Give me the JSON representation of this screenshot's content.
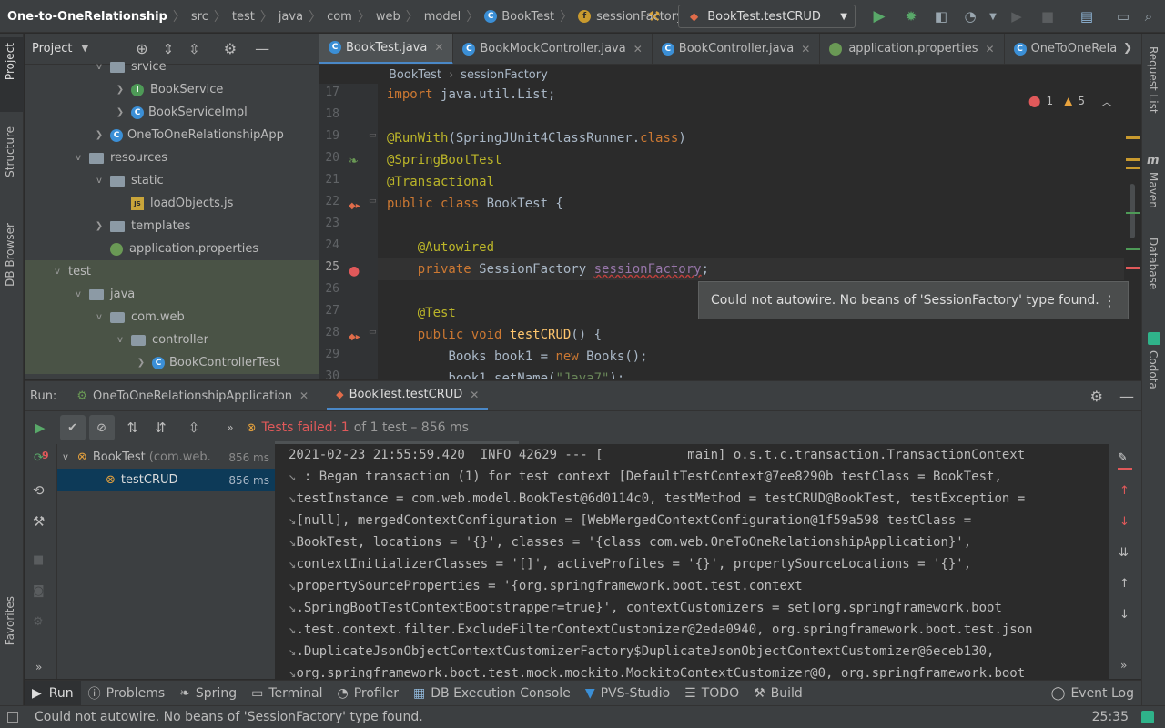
{
  "nav": {
    "breadcrumbs": [
      "One-to-OneRelationship",
      "src",
      "test",
      "java",
      "com",
      "web",
      "model",
      "BookTest",
      "sessionFactory"
    ],
    "run_config": "BookTest.testCRUD"
  },
  "left_strip": {
    "project": "Project",
    "structure": "Structure",
    "db_browser": "DB Browser",
    "favorites": "Favorites"
  },
  "right_strip": {
    "request_list": "Request List",
    "maven": "Maven",
    "database": "Database",
    "codota": "Codota"
  },
  "project_panel": {
    "title": "Project",
    "tree": [
      {
        "label": "srvice",
        "indent": 2,
        "icon": "folder-icon",
        "twisty": "v"
      },
      {
        "label": "BookService",
        "indent": 3,
        "icon": "interface-icon",
        "twisty": ">"
      },
      {
        "label": "BookServiceImpl",
        "indent": 3,
        "icon": "class-icon",
        "twisty": ">"
      },
      {
        "label": "OneToOneRelationshipApp",
        "indent": 2,
        "icon": "class-icon",
        "twisty": ">"
      },
      {
        "label": "resources",
        "indent": 1,
        "icon": "folder-icon",
        "twisty": "v"
      },
      {
        "label": "static",
        "indent": 2,
        "icon": "folder-icon",
        "twisty": "v"
      },
      {
        "label": "loadObjects.js",
        "indent": 3,
        "icon": "js-file-icon",
        "twisty": ""
      },
      {
        "label": "templates",
        "indent": 2,
        "icon": "folder-icon",
        "twisty": ">"
      },
      {
        "label": "application.properties",
        "indent": 2,
        "icon": "properties-file-icon",
        "twisty": ""
      },
      {
        "label": "test",
        "indent": 0,
        "icon": "",
        "twisty": "v",
        "green": true
      },
      {
        "label": "java",
        "indent": 1,
        "icon": "folder-icon",
        "twisty": "v",
        "green": true
      },
      {
        "label": "com.web",
        "indent": 2,
        "icon": "package-icon",
        "twisty": "v",
        "green": true
      },
      {
        "label": "controller",
        "indent": 3,
        "icon": "package-icon",
        "twisty": "v",
        "green": true
      },
      {
        "label": "BookControllerTest",
        "indent": 4,
        "icon": "class-icon",
        "twisty": ">",
        "green": true
      }
    ]
  },
  "editor": {
    "tabs": [
      {
        "label": "BookTest.java",
        "active": true
      },
      {
        "label": "BookMockController.java"
      },
      {
        "label": "BookController.java"
      },
      {
        "label": "application.properties"
      },
      {
        "label": "OneToOneRela"
      }
    ],
    "crumbs": [
      "BookTest",
      "sessionFactory"
    ],
    "line_numbers": [
      "17",
      "18",
      "19",
      "20",
      "21",
      "22",
      "23",
      "24",
      "25",
      "26",
      "27",
      "28",
      "29",
      "30"
    ],
    "code": {
      "l17_kw": "import ",
      "l17_rest": "java.util.List;",
      "l19_an": "@RunWith",
      "l19_rest": "(SpringJUnit4ClassRunner.",
      "l19_kw": "class",
      "l19_end": ")",
      "l20_an": "@SpringBootTest",
      "l21_an": "@Transactional",
      "l22_kw": "public class ",
      "l22_rest": "BookTest {",
      "l24_an": "@Autowired",
      "l25_kw": "private ",
      "l25_type": "SessionFactory ",
      "l25_fld": "sessionFactory",
      "l25_end": ";",
      "l27_an": "@Test",
      "l28_kw": "public void ",
      "l28_fn": "testCRUD",
      "l28_end": "() {",
      "l29_a": "Books book1 = ",
      "l29_kw": "new ",
      "l29_b": "Books();",
      "l30_a": "book1.setName(",
      "l30_str": "\"Java7\"",
      "l30_b": ");"
    },
    "errors": "1",
    "warnings": "5",
    "tooltip": "Could not autowire. No beans of 'SessionFactory' type found."
  },
  "run_panel": {
    "label": "Run:",
    "tabs": [
      {
        "label": "OneToOneRelationshipApplication"
      },
      {
        "label": "BookTest.testCRUD",
        "active": true
      }
    ],
    "status_failed": "Tests failed: 1",
    "status_rest": "of 1 test – 856 ms",
    "tests": [
      {
        "name": "BookTest",
        "detail": "(com.web.",
        "time": "856 ms"
      },
      {
        "name": "testCRUD",
        "time": "856 ms"
      }
    ],
    "console": [
      "2021-02-23 21:55:59.420  INFO 42629 --- [           main] o.s.t.c.transaction.TransactionContext",
      " : Began transaction (1) for test context [DefaultTestContext@7ee8290b testClass = BookTest,",
      "testInstance = com.web.model.BookTest@6d0114c0, testMethod = testCRUD@BookTest, testException =",
      "[null], mergedContextConfiguration = [WebMergedContextConfiguration@1f59a598 testClass =",
      "BookTest, locations = '{}', classes = '{class com.web.OneToOneRelationshipApplication}',",
      "contextInitializerClasses = '[]', activeProfiles = '{}', propertySourceLocations = '{}',",
      "propertySourceProperties = '{org.springframework.boot.test.context",
      ".SpringBootTestContextBootstrapper=true}', contextCustomizers = set[org.springframework.boot",
      ".test.context.filter.ExcludeFilterContextCustomizer@2eda0940, org.springframework.boot.test.json",
      ".DuplicateJsonObjectContextCustomizerFactory$DuplicateJsonObjectContextCustomizer@6eceb130,",
      "org.springframework.boot.test.mock.mockito.MockitoContextCustomizer@0, org.springframework.boot"
    ]
  },
  "bottom_bar": [
    "Run",
    "Problems",
    "Spring",
    "Terminal",
    "Profiler",
    "DB Execution Console",
    "PVS-Studio",
    "TODO",
    "Build"
  ],
  "event_log": "Event Log",
  "status": {
    "message": "Could not autowire. No beans of 'SessionFactory' type found.",
    "position": "25:35"
  },
  "colors": {
    "accent": "#4a88c7",
    "error": "#e0595a",
    "test_fail": "#e8a33d",
    "run_green": "#59a869"
  }
}
